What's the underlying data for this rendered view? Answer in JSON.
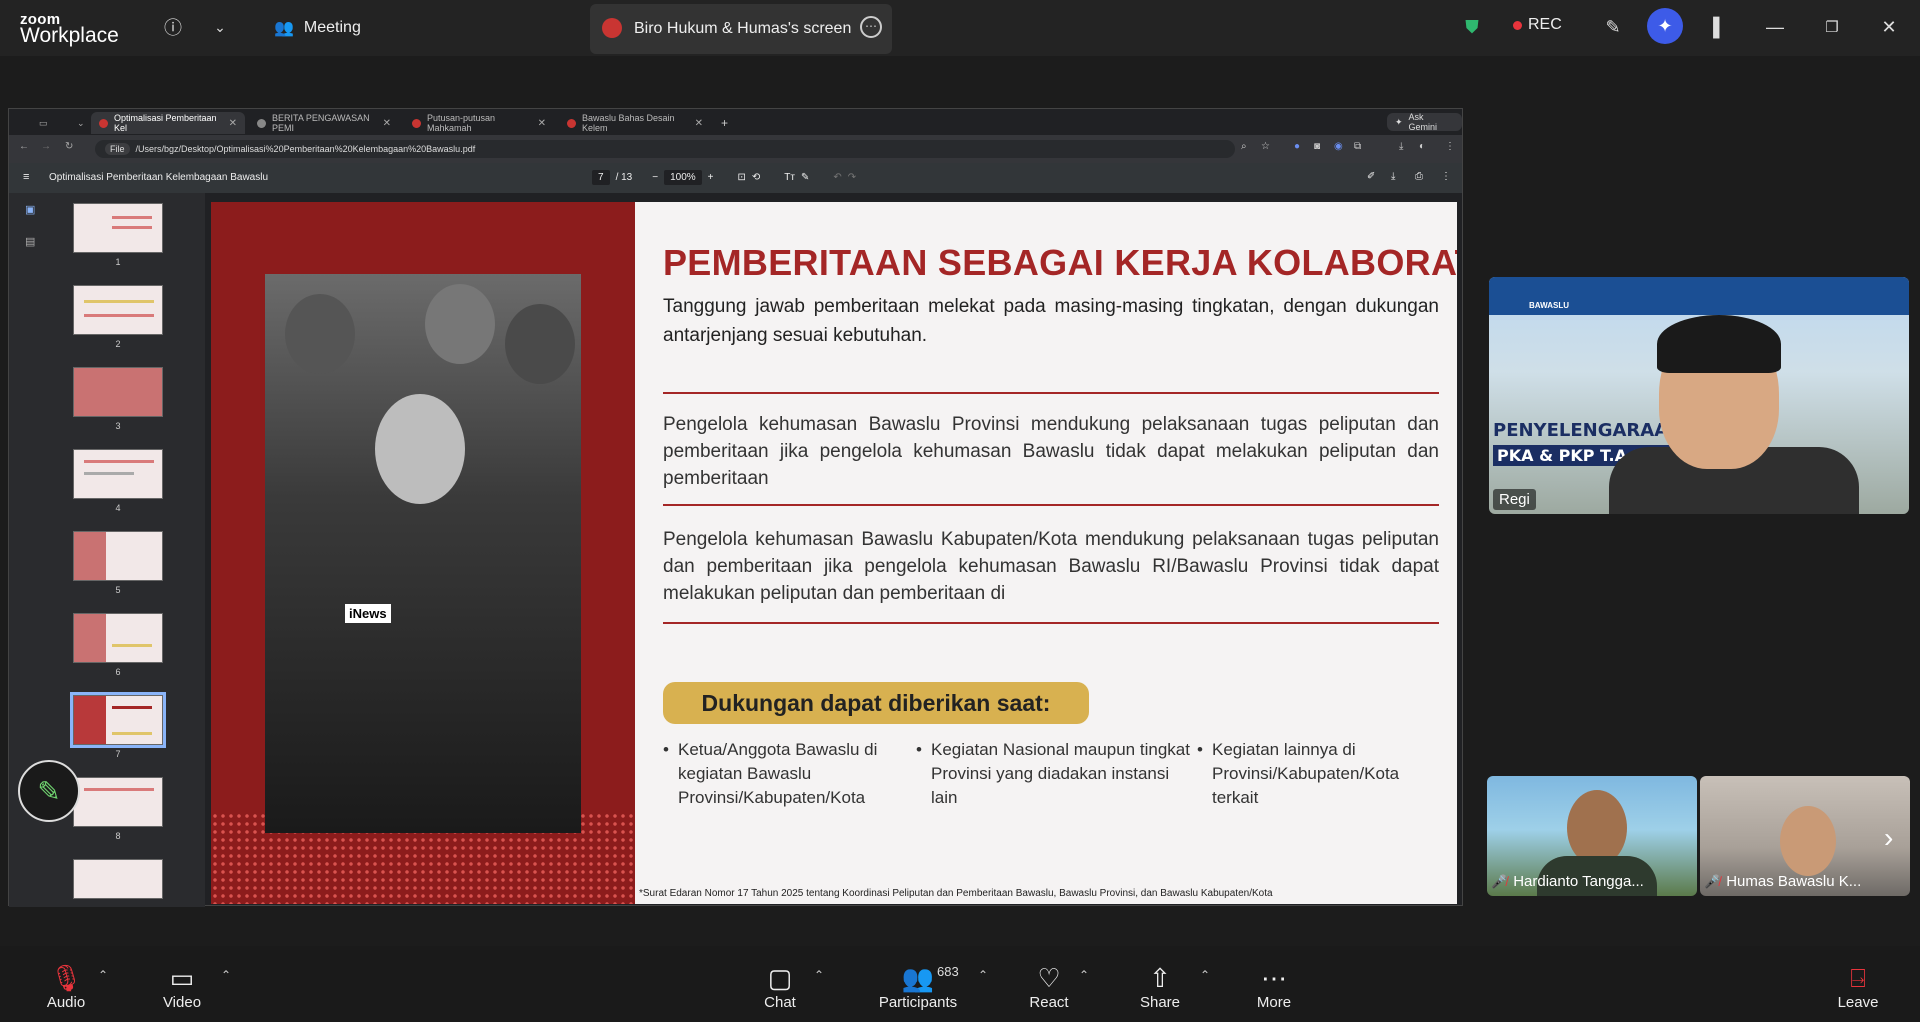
{
  "app": {
    "logo_line1": "zoom",
    "logo_line2": "Workplace"
  },
  "topbar": {
    "meeting_label": "Meeting",
    "share_tab_label": "Biro Hukum & Humas's screen",
    "rec_label": "REC"
  },
  "browser": {
    "tabs": [
      {
        "label": "Optimalisasi Pemberitaan Kel"
      },
      {
        "label": "BERITA PENGAWASAN PEMI"
      },
      {
        "label": "Putusan-putusan Mahkamah"
      },
      {
        "label": "Bawaslu Bahas Desain Kelem"
      }
    ],
    "ask_gemini": "Ask Gemini",
    "file_chip": "File",
    "url": "/Users/bgz/Desktop/Optimalisasi%20Pemberitaan%20Kelembagaan%20Bawaslu.pdf",
    "pdf_title": "Optimalisasi Pemberitaan Kelembagaan Bawaslu",
    "page_current": "7",
    "page_total": "/ 13",
    "zoom": "100%",
    "thumb_numbers": [
      "1",
      "2",
      "3",
      "4",
      "5",
      "6",
      "7",
      "8"
    ]
  },
  "slide": {
    "title": "PEMBERITAAN SEBAGAI KERJA KOLABORATIF",
    "subtitle": "Tanggung jawab pemberitaan melekat pada masing-masing tingkatan, dengan dukungan antarjenjang sesuai kebutuhan.",
    "para1": "Pengelola kehumasan Bawaslu Provinsi mendukung pelaksanaan tugas peliputan dan pemberitaan jika pengelola kehumasan Bawaslu tidak dapat melakukan peliputan dan pemberitaan",
    "para2": "Pengelola kehumasan Bawaslu Kabupaten/Kota mendukung pelaksanaan tugas peliputan dan pemberitaan jika pengelola kehumasan Bawaslu RI/Bawaslu Provinsi tidak dapat melakukan peliputan dan pemberitaan di",
    "pill": "Dukungan dapat diberikan saat:",
    "bullets": [
      "Ketua/Anggota Bawaslu di kegiatan Bawaslu Provinsi/Kabupaten/Kota",
      "Kegiatan Nasional maupun tingkat Provinsi yang diadakan instansi lain",
      "Kegiatan lainnya di Provinsi/Kabupaten/Kota terkait"
    ],
    "footnote": "*Surat Edaran Nomor 17 Tahun 2025 tentang Koordinasi Peliputan dan Pemberitaan Bawaslu, Bawaslu Provinsi, dan Bawaslu Kabupaten/Kota",
    "photo_label": "iNews"
  },
  "speaker": {
    "name": "Regi",
    "banner_line1": "PENYELENGARAAN",
    "banner_line2": "PKA & PKP T.A 2026",
    "banner_logo_text": "BAWASLU"
  },
  "participants": [
    {
      "name": "Hardianto Tangga..."
    },
    {
      "name": "Humas Bawaslu K..."
    }
  ],
  "bottombar": {
    "audio": "Audio",
    "video": "Video",
    "chat": "Chat",
    "participants": "Participants",
    "participants_count": "683",
    "react": "React",
    "share": "Share",
    "more": "More",
    "leave": "Leave"
  },
  "colors": {
    "accent_red": "#a42626",
    "pill_gold": "#d8b150",
    "rec_red": "#e8343c"
  }
}
